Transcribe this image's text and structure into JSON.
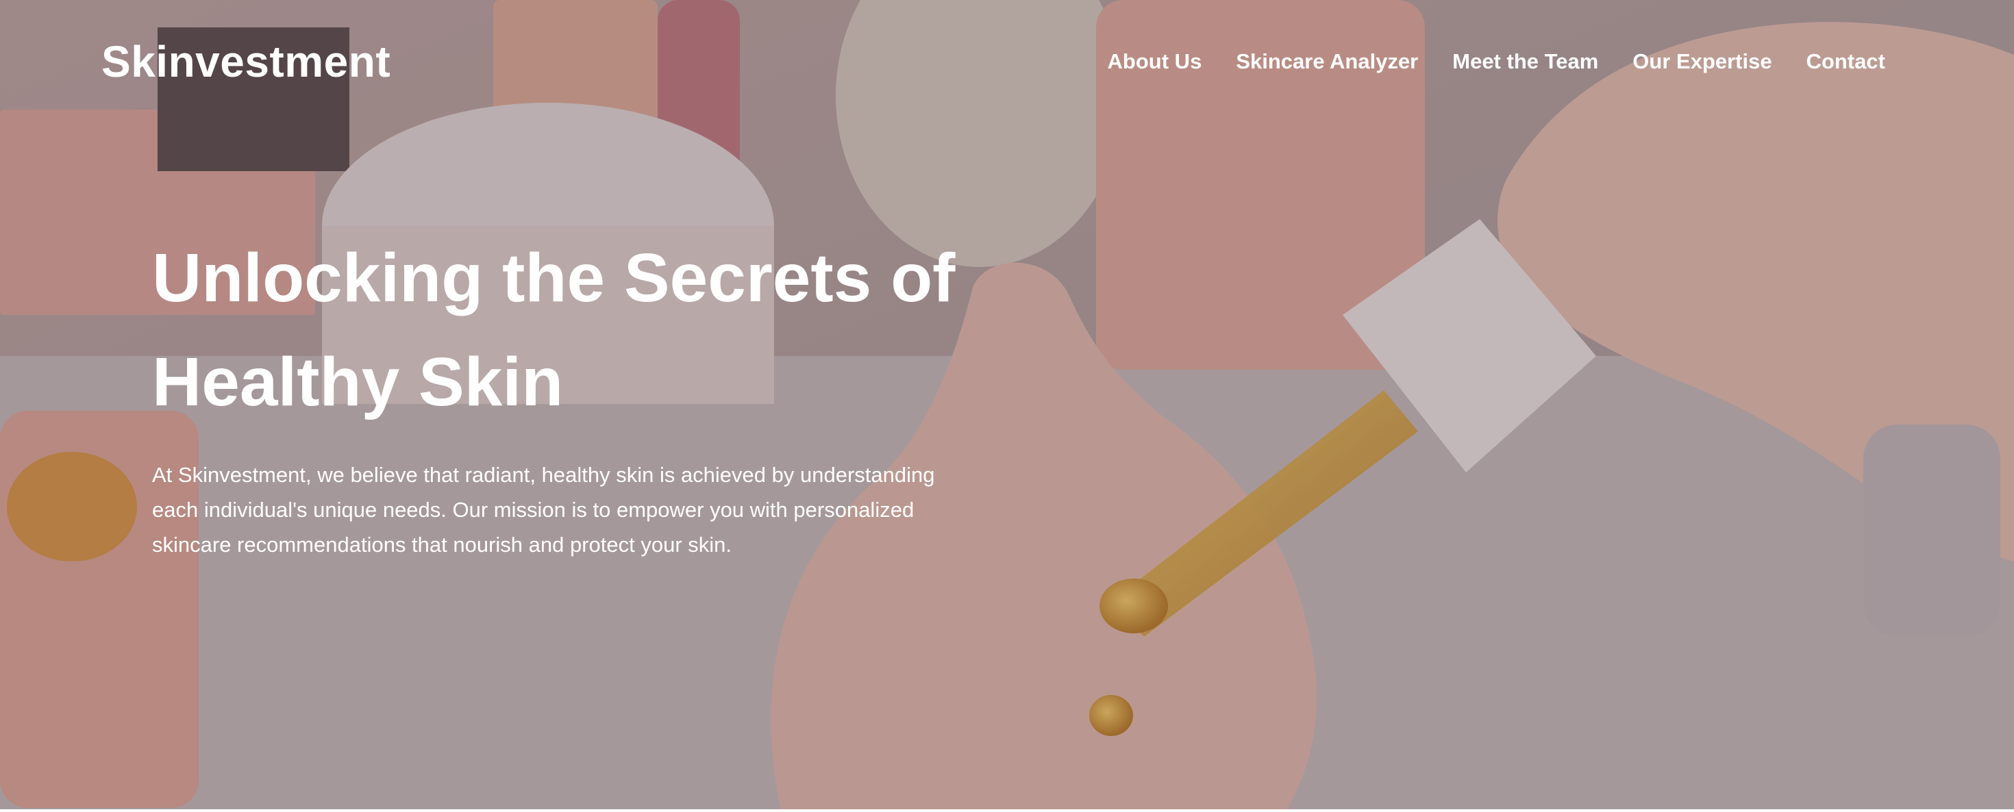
{
  "header": {
    "brand": "Skinvestment",
    "nav": [
      {
        "label": "About Us"
      },
      {
        "label": "Skincare Analyzer"
      },
      {
        "label": "Meet the Team"
      },
      {
        "label": "Our Expertise"
      },
      {
        "label": "Contact"
      }
    ]
  },
  "hero": {
    "headline": "Unlocking the Secrets of Healthy Skin",
    "intro": "At Skinvestment, we believe that radiant, healthy skin is achieved by understanding each individual's unique needs. Our mission is to empower you with personalized skincare recommendations that nourish and protect your skin.",
    "background": "Photo of hands applying golden serum from a dropper onto skin, surrounded by pink skincare products"
  },
  "colors": {
    "text": "#ffffff",
    "overlay": "#6e6064",
    "accent_serum": "#c98a1a",
    "product_pink": "#e9a79a"
  }
}
